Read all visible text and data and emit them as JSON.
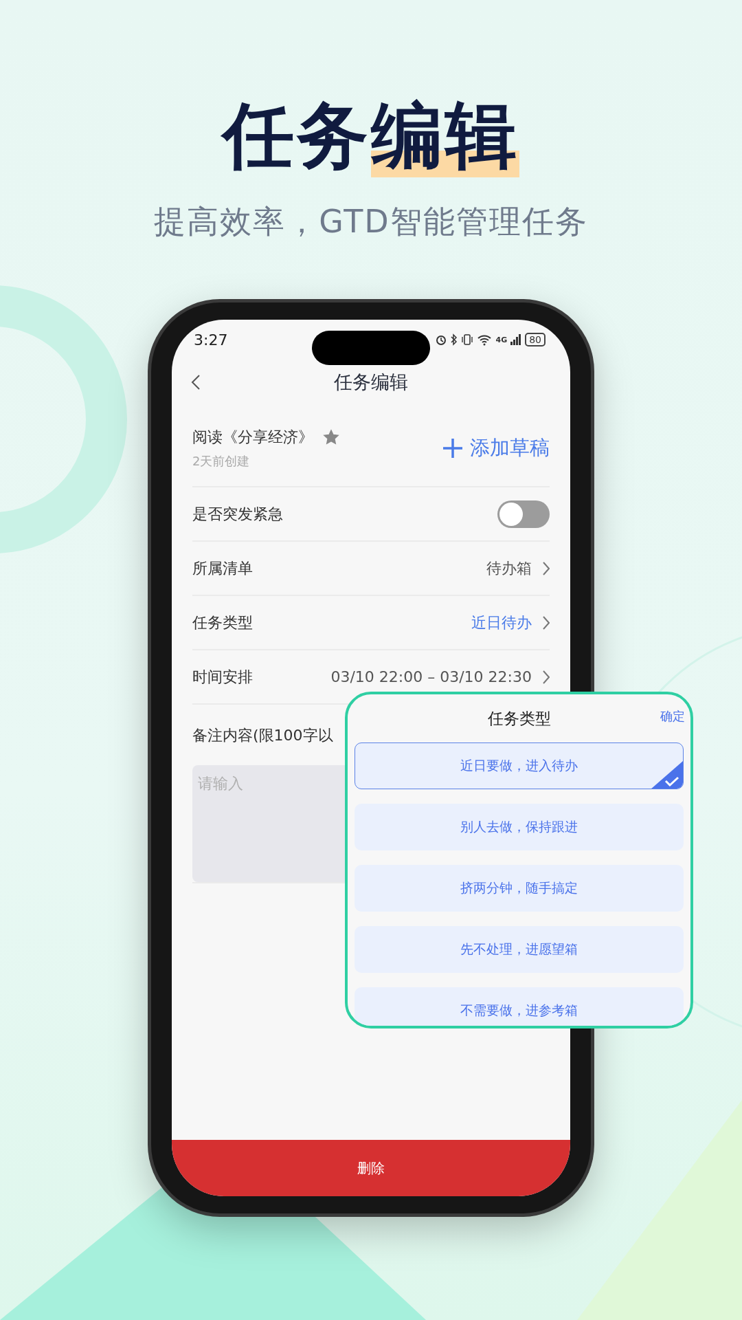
{
  "hero": {
    "title_plain": "任务",
    "title_highlight": "编辑",
    "subtitle": "提高效率，GTD智能管理任务"
  },
  "status_bar": {
    "time": "3:27",
    "network": "4G",
    "battery": "80"
  },
  "nav": {
    "title": "任务编辑"
  },
  "task": {
    "name": "阅读《分享经济》",
    "starred": true,
    "created": "2天前创建",
    "add_draft": "添加草稿"
  },
  "rows": [
    {
      "kind": "toggle",
      "label": "是否突发紧急",
      "on": false
    },
    {
      "kind": "link",
      "label": "所属清单",
      "value": "待办箱",
      "accent": false
    },
    {
      "kind": "link",
      "label": "任务类型",
      "value": "近日待办",
      "accent": true
    },
    {
      "kind": "link",
      "label": "时间安排",
      "value": "03/10 22:00 – 03/10 22:30",
      "accent": false
    }
  ],
  "notes": {
    "label": "备注内容(限100字以",
    "placeholder": "请输入"
  },
  "delete_button": "删除",
  "picker": {
    "title": "任务类型",
    "confirm": "确定",
    "options": [
      {
        "label": "近日要做，进入待办",
        "selected": true
      },
      {
        "label": "别人去做，保持跟进",
        "selected": false
      },
      {
        "label": "挤两分钟，随手搞定",
        "selected": false
      },
      {
        "label": "先不处理，进愿望箱",
        "selected": false
      },
      {
        "label": "不需要做，进参考箱",
        "selected": false
      }
    ]
  }
}
